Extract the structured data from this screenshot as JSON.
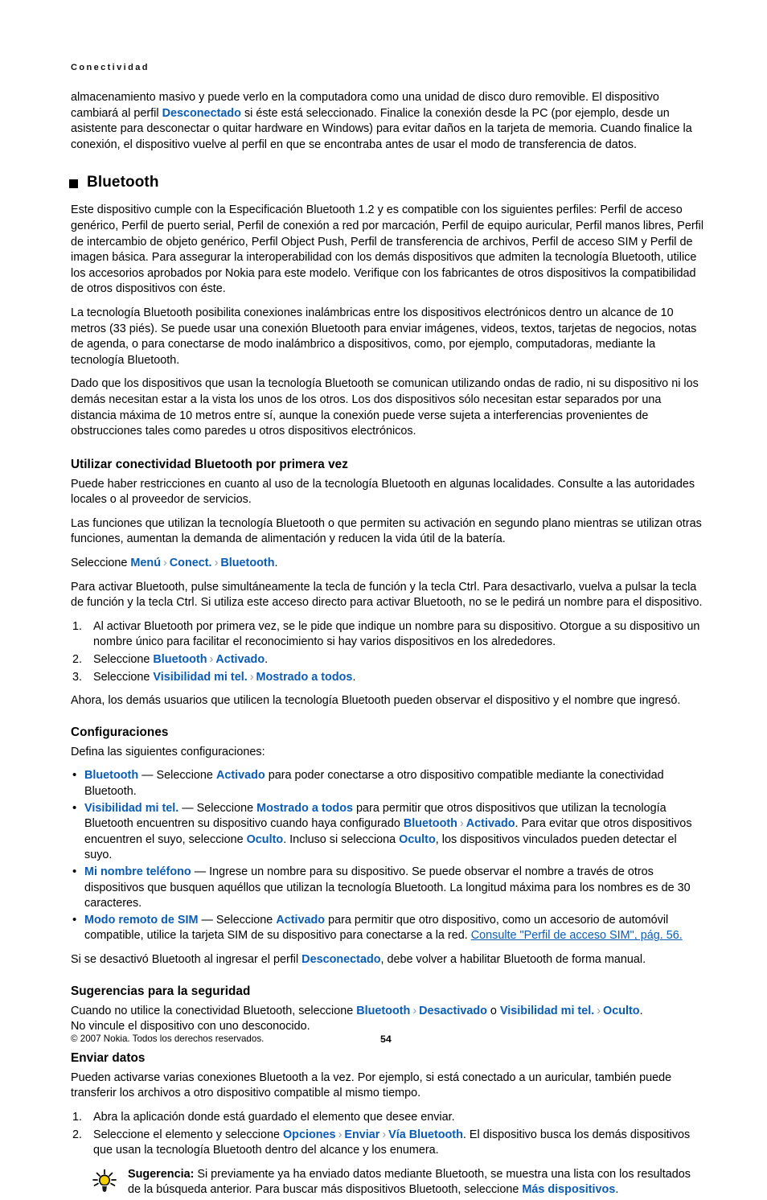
{
  "running_head": "Conectividad",
  "intro": {
    "line": "almacenamiento masivo y puede verlo en la computadora como una unidad de disco duro removible. El dispositivo cambiará al perfil ",
    "link1": "Desconectado",
    "line2": " si éste está seleccionado. Finalice la conexión desde la PC (por ejemplo, desde un asistente para desconectar o quitar hardware en Windows) para evitar daños en la tarjeta de memoria. Cuando finalice la conexión, el dispositivo vuelve al perfil en que se encontraba antes de usar el modo de transferencia de datos."
  },
  "heading_main": "Bluetooth",
  "paragraphs": {
    "p1": "Este dispositivo cumple con la Especificación Bluetooth 1.2 y es compatible con los siguientes perfiles: Perfil de acceso genérico, Perfil de puerto serial, Perfil de conexión a red por marcación, Perfil de equipo auricular, Perfil manos libres, Perfil de intercambio de objeto genérico, Perfil Object Push, Perfil de transferencia de archivos, Perfil de acceso SIM y Perfil de imagen básica. Para assegurar la interoperabilidad con los demás dispositivos que admiten la tecnología Bluetooth, utilice los accesorios aprobados por Nokia para este modelo. Verifique con los fabricantes de otros dispositivos la compatibilidad de otros dispositivos con éste.",
    "p2": "La tecnología Bluetooth posibilita conexiones inalámbricas entre los dispositivos electrónicos dentro un alcance de 10 metros (33 piés). Se puede usar una conexión Bluetooth para enviar imágenes, videos, textos, tarjetas de negocios, notas de agenda, o para conectarse de modo inalámbrico a dispositivos, como, por ejemplo, computadoras, mediante la tecnología Bluetooth.",
    "p3": "Dado que los dispositivos que usan la tecnología Bluetooth se comunican utilizando ondas de radio, ni su dispositivo ni los demás necesitan estar a la vista los unos de los otros. Los dos dispositivos sólo necesitan estar separados por una distancia máxima de 10 metros entre sí, aunque la conexión puede verse sujeta a interferencias provenientes de obstrucciones tales como paredes u otros dispositivos electrónicos."
  },
  "section_first_use": {
    "heading": "Utilizar conectividad Bluetooth por primera vez",
    "p1": "Puede haber restricciones en cuanto al uso de la tecnología Bluetooth en algunas localidades. Consulte a las autoridades locales o al proveedor de servicios.",
    "p2": "Las funciones que utilizan la tecnología Bluetooth o que permiten su activación en segundo plano mientras se utilizan otras funciones, aumentan la demanda de alimentación y reducen la vida útil de la batería.",
    "path_intro": "Seleccione ",
    "path_menu": "Menú",
    "path_conect": "Conect.",
    "path_bluetooth": "Bluetooth",
    "p3": "Para activar Bluetooth, pulse simultáneamente la tecla de función y la tecla Ctrl. Para desactivarlo, vuelva a pulsar la tecla de función y la tecla Ctrl. Si utiliza este acceso directo para activar Bluetooth, no se le pedirá un nombre para el dispositivo.",
    "steps": [
      {
        "num": "1.",
        "text": "Al activar Bluetooth por primera vez, se le pide que indique un nombre para su dispositivo. Otorgue a su dispositivo un nombre único para facilitar el reconocimiento si hay varios dispositivos en los alrededores."
      },
      {
        "num": "2.",
        "prefix": "Seleccione ",
        "link1": "Bluetooth",
        "link2": "Activado",
        "suffix": "."
      },
      {
        "num": "3.",
        "prefix": "Seleccione ",
        "link1": "Visibilidad mi tel.",
        "link2": "Mostrado a todos",
        "suffix": "."
      }
    ],
    "p4": "Ahora, los demás usuarios que utilicen la tecnología Bluetooth pueden observar el dispositivo y el nombre que ingresó."
  },
  "section_config": {
    "heading": "Configuraciones",
    "intro": "Defina las siguientes configuraciones:",
    "bullets": [
      {
        "term": "Bluetooth",
        "a": " — Seleccione ",
        "link1": "Activado",
        "b": " para poder conectarse a otro dispositivo compatible mediante la conectividad Bluetooth."
      },
      {
        "term": "Visibilidad mi tel.",
        "a": " — Seleccione ",
        "link1": "Mostrado a todos",
        "b": " para permitir que otros dispositivos que utilizan la tecnología Bluetooth encuentren su dispositivo cuando haya configurado ",
        "link2": "Bluetooth",
        "link3": "Activado",
        "c": ". Para evitar que otros dispositivos encuentren el suyo, seleccione ",
        "link4": "Oculto",
        "d": ". Incluso si selecciona ",
        "link5": "Oculto",
        "e": ", los dispositivos vinculados pueden detectar el suyo."
      },
      {
        "term": "Mi nombre teléfono",
        "a": " — Ingrese un nombre para su dispositivo. Se puede observar el nombre a través de otros dispositivos que busquen aquéllos que utilizan la tecnología Bluetooth. La longitud máxima para los nombres es de 30 caracteres."
      },
      {
        "term": "Modo remoto de SIM",
        "a": " — Seleccione ",
        "link1": "Activado",
        "b": " para permitir que otro dispositivo, como un accesorio de automóvil compatible, utilice la tarjeta SIM de su dispositivo para conectarse a la red. ",
        "crossref": "Consulte \"Perfil de acceso SIM\", pág. 56."
      }
    ],
    "closing_a": "Si se desactivó Bluetooth al ingresar el perfil ",
    "closing_link": "Desconectado",
    "closing_b": ", debe volver a habilitar Bluetooth de forma manual."
  },
  "section_security": {
    "heading": "Sugerencias para la seguridad",
    "p1_a": "Cuando no utilice la conectividad Bluetooth, seleccione ",
    "p1_link1": "Bluetooth",
    "p1_link2": "Desactivado",
    "p1_mid": " o ",
    "p1_link3": "Visibilidad mi tel.",
    "p1_link4": "Oculto",
    "p1_end": ".",
    "p2": "No vincule el dispositivo con uno desconocido."
  },
  "section_send": {
    "heading": "Enviar datos",
    "p1": "Pueden activarse varias conexiones Bluetooth a la vez. Por ejemplo, si está conectado a un auricular, también puede transferir los archivos a otro dispositivo compatible al mismo tiempo.",
    "steps": [
      {
        "num": "1.",
        "text": "Abra la aplicación donde está guardado el elemento que desee enviar."
      },
      {
        "num": "2.",
        "prefix": "Seleccione el elemento y seleccione ",
        "link1": "Opciones",
        "link2": "Enviar",
        "link3": "Vía Bluetooth",
        "suffix": ". El dispositivo busca los demás dispositivos que usan la tecnología Bluetooth dentro del alcance y los enumera."
      }
    ],
    "tip": {
      "icon": "lightbulb-tip-icon",
      "label": "Sugerencia:",
      "text_a": " Si previamente ya ha enviado datos mediante Bluetooth, se muestra una lista con los resultados de la búsqueda anterior. Para buscar más dispositivos Bluetooth, seleccione ",
      "link": "Más dispositivos",
      "text_b": "."
    }
  },
  "footer": {
    "copyright": "© 2007 Nokia. Todos los derechos reservados.",
    "page_number": "54"
  },
  "colors": {
    "link": "#0b5cb5",
    "separator": "#8c9aa8",
    "tip_bulb": "#f5d000",
    "text": "#000000"
  }
}
